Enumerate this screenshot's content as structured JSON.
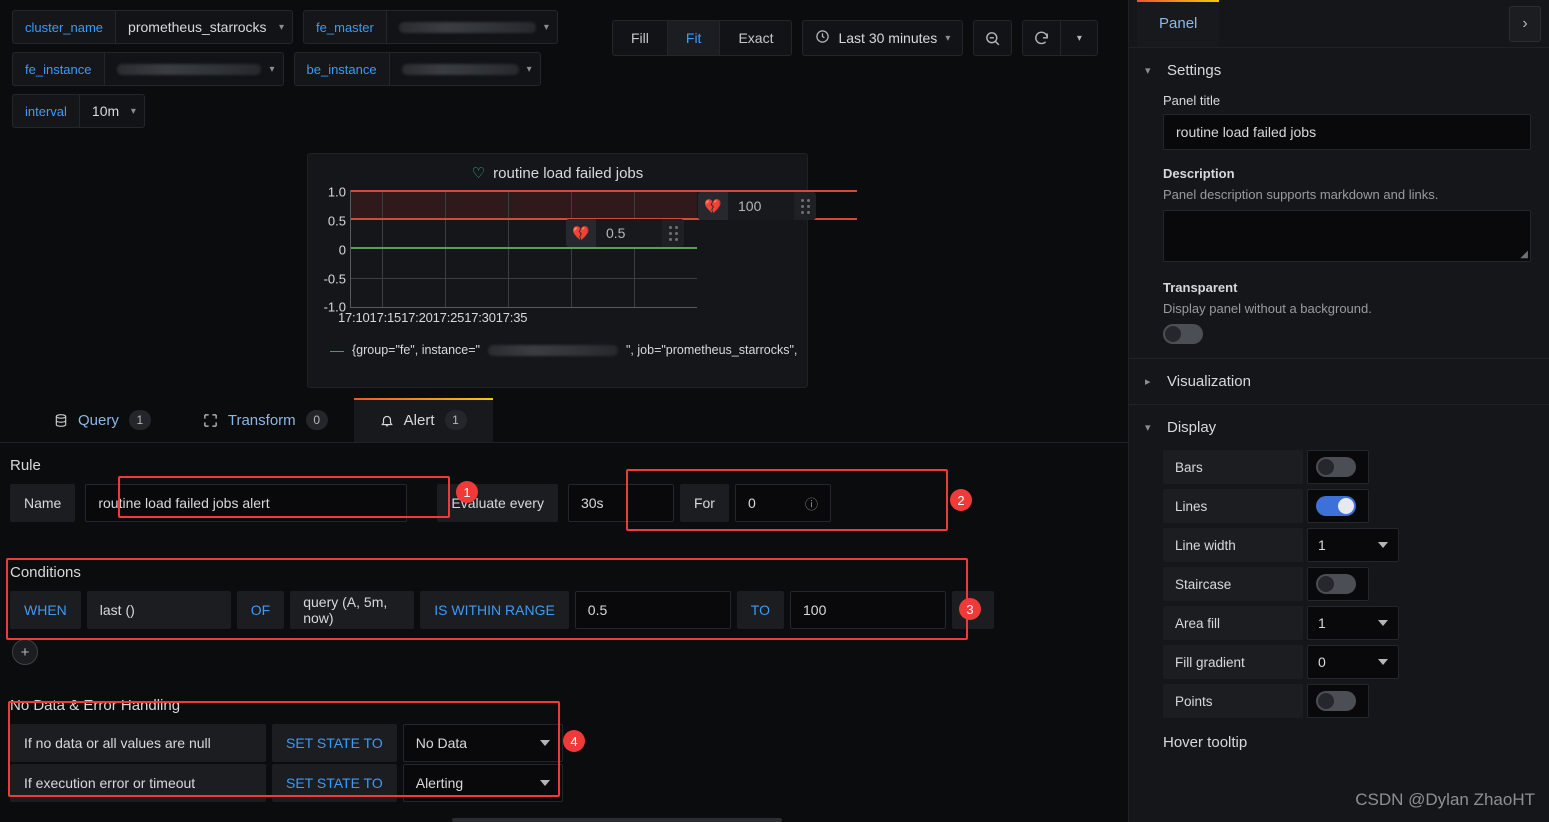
{
  "variables": [
    {
      "label": "cluster_name",
      "value": "prometheus_starrocks",
      "redacted": false
    },
    {
      "label": "fe_master",
      "value": "",
      "redacted": true
    },
    {
      "label": "fe_instance",
      "value": "",
      "redacted": true
    },
    {
      "label": "be_instance",
      "value": "",
      "redacted": true
    },
    {
      "label": "interval",
      "value": "10m",
      "redacted": false
    }
  ],
  "toolbar": {
    "fill": "Fill",
    "fit": "Fit",
    "exact": "Exact",
    "time_range": "Last 30 minutes",
    "zoom_out_icon": "zoom-out-icon",
    "refresh_icon": "refresh-icon",
    "active_segment": "Fit"
  },
  "panel": {
    "title": "routine load failed jobs",
    "legend": "{group=\"fe\", instance=\"",
    "legend_tail": "\", job=\"prometheus_starrocks\", sta",
    "thresholds": [
      {
        "value": "0.5",
        "icon": "broken-heart-icon"
      },
      {
        "value": "100",
        "icon": "broken-heart-icon"
      }
    ]
  },
  "chart_data": {
    "type": "line",
    "title": "routine load failed jobs",
    "x": [
      "17:10",
      "17:15",
      "17:20",
      "17:25",
      "17:30",
      "17:35"
    ],
    "series": [
      {
        "name": "{group=\"fe\", instance=\"…\", job=\"prometheus_starrocks\", sta",
        "values": [
          0,
          0,
          0,
          0,
          0,
          0
        ],
        "color": "#5a9e5a"
      }
    ],
    "ylim": [
      -1.0,
      1.0
    ],
    "yticks": [
      "1.0",
      "0.5",
      "0",
      "-0.5",
      "-1.0"
    ],
    "xlabel": "",
    "ylabel": "",
    "grid": true,
    "thresholds": [
      {
        "value": 0.5,
        "color": "#d44a3a",
        "band_to": 1.0
      },
      {
        "value": 100,
        "color": "#d44a3a"
      }
    ],
    "legend_position": "bottom"
  },
  "tabs": [
    {
      "label": "Query",
      "count": "1",
      "icon": "database-icon",
      "active": false
    },
    {
      "label": "Transform",
      "count": "0",
      "icon": "transform-icon",
      "active": false
    },
    {
      "label": "Alert",
      "count": "1",
      "icon": "bell-icon",
      "active": true
    }
  ],
  "alert": {
    "rule_heading": "Rule",
    "name_label": "Name",
    "name_value": "routine load failed jobs alert",
    "evaluate_label": "Evaluate every",
    "evaluate_value": "30s",
    "for_label": "For",
    "for_value": "0",
    "conditions_heading": "Conditions",
    "condition": {
      "when": "WHEN",
      "reducer": "last ()",
      "of": "OF",
      "query": "query (A, 5m, now)",
      "evaluator": "IS WITHIN RANGE",
      "from": "0.5",
      "to_label": "TO",
      "to": "100",
      "delete_icon": "trash-icon"
    },
    "add_condition_icon": "plus-circle-icon",
    "nodata_heading": "No Data & Error Handling",
    "nodata_rows": [
      {
        "label": "If no data or all values are null",
        "action": "SET STATE TO",
        "state": "No Data"
      },
      {
        "label": "If execution error or timeout",
        "action": "SET STATE TO",
        "state": "Alerting"
      }
    ],
    "annotations": [
      "1",
      "2",
      "3",
      "4"
    ]
  },
  "options": {
    "tab": "Panel",
    "expand_icon": "chevron-right-icon",
    "settings": {
      "heading": "Settings",
      "panel_title_label": "Panel title",
      "panel_title_value": "routine load failed jobs",
      "description_label": "Description",
      "description_sub": "Panel description supports markdown and links.",
      "description_value": "",
      "transparent_label": "Transparent",
      "transparent_sub": "Display panel without a background.",
      "transparent_on": false
    },
    "visualization_heading": "Visualization",
    "display": {
      "heading": "Display",
      "rows": [
        {
          "label": "Bars",
          "type": "toggle",
          "value": "off"
        },
        {
          "label": "Lines",
          "type": "toggle",
          "value": "on"
        },
        {
          "label": "Line width",
          "type": "select",
          "value": "1"
        },
        {
          "label": "Staircase",
          "type": "toggle",
          "value": "off"
        },
        {
          "label": "Area fill",
          "type": "select",
          "value": "1"
        },
        {
          "label": "Fill gradient",
          "type": "select",
          "value": "0"
        },
        {
          "label": "Points",
          "type": "toggle",
          "value": "off"
        }
      ],
      "next_heading": "Hover tooltip"
    }
  },
  "watermark": "CSDN @Dylan ZhaoHT",
  "colors": {
    "accent_blue": "#3d9bf5",
    "alert_red": "#f03a3a",
    "threshold_red": "#d44a3a",
    "series_green": "#5a9e5a",
    "toggle_on": "#3d71d9",
    "tab_gradient_start": "#f2552c",
    "tab_gradient_end": "#f2cc0c"
  }
}
